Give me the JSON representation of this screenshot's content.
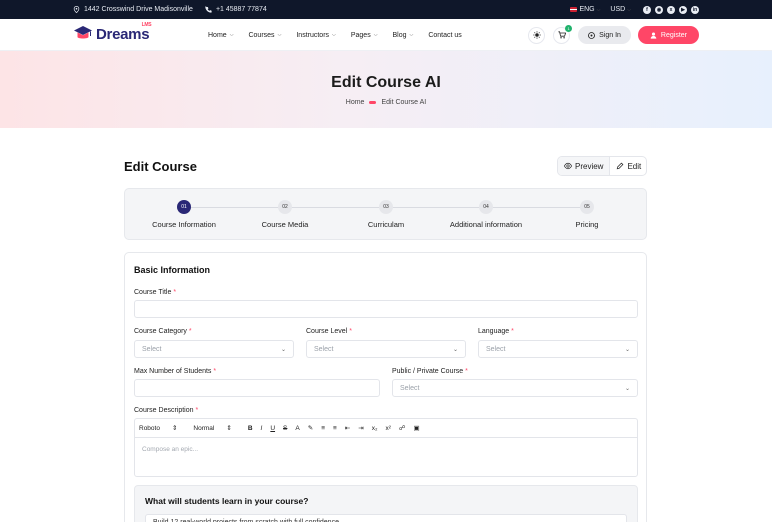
{
  "topbar": {
    "address": "1442 Crosswind Drive Madisonville",
    "phone": "+1 45887 77874",
    "language": "ENG",
    "currency": "USD",
    "socials": [
      "facebook-icon",
      "instagram-icon",
      "twitter-icon",
      "youtube-icon",
      "linkedin-icon"
    ]
  },
  "header": {
    "logo_text": "Dreams",
    "logo_sup": "LMS",
    "nav": [
      {
        "label": "Home",
        "has_dropdown": true
      },
      {
        "label": "Courses",
        "has_dropdown": true
      },
      {
        "label": "Instructors",
        "has_dropdown": true
      },
      {
        "label": "Pages",
        "has_dropdown": true
      },
      {
        "label": "Blog",
        "has_dropdown": true
      },
      {
        "label": "Contact us",
        "has_dropdown": false
      }
    ],
    "cart_count": "1",
    "signin_label": "Sign In",
    "register_label": "Register",
    "accent": "#ff4667",
    "brand": "#2a2876"
  },
  "hero": {
    "title": "Edit Course AI",
    "breadcrumb": [
      "Home",
      "Edit Course AI"
    ]
  },
  "page": {
    "title": "Edit Course",
    "preview_label": "Preview",
    "edit_label": "Edit"
  },
  "steps": [
    {
      "num": "01",
      "label": "Course Information",
      "active": true
    },
    {
      "num": "02",
      "label": "Course Media",
      "active": false
    },
    {
      "num": "03",
      "label": "Curriculam",
      "active": false
    },
    {
      "num": "04",
      "label": "Additional information",
      "active": false
    },
    {
      "num": "05",
      "label": "Pricing",
      "active": false
    }
  ],
  "form": {
    "section_title": "Basic Information",
    "course_title_label": "Course Title",
    "course_title_value": "",
    "category_label": "Course Category",
    "category_value": "Select",
    "level_label": "Course Level",
    "level_value": "Select",
    "language_label": "Language",
    "language_value": "Select",
    "max_students_label": "Max Number of Students",
    "max_students_value": "",
    "visibility_label": "Public / Private Course",
    "visibility_value": "Select",
    "description_label": "Course Description",
    "editor_font": "Roboto",
    "editor_size": "Normal",
    "editor_placeholder": "Compose an epic...",
    "learn_title": "What will students learn in your course?",
    "learn_value": "Build 12 real-world projects from scratch with full confidence"
  }
}
